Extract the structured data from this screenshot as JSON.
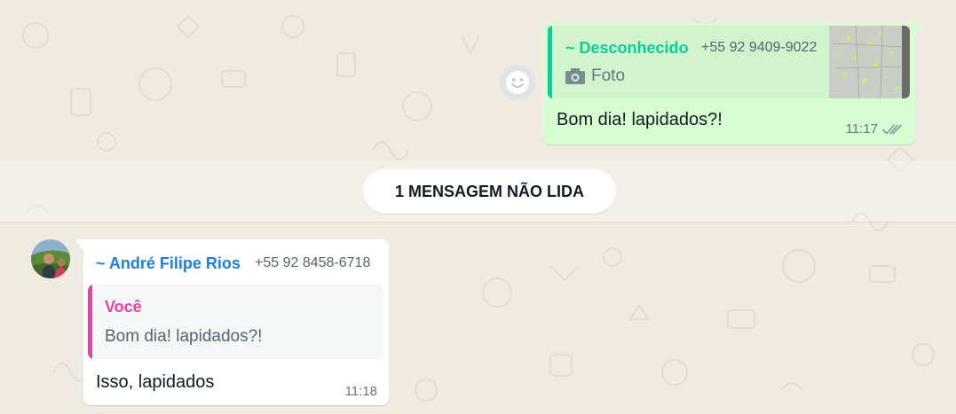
{
  "outgoing": {
    "quote": {
      "author": "~ Desconhecido",
      "phone": "+55 92 9409-9022",
      "media_icon": "camera-icon",
      "media_label": "Foto"
    },
    "text": "Bom dia! lapidados?!",
    "time": "11:17",
    "status_icon": "double-check-icon"
  },
  "divider": {
    "label": "1 MENSAGEM NÃO LIDA"
  },
  "incoming": {
    "sender_name": "~ André Filipe Rios",
    "sender_phone": "+55 92 8458-6718",
    "quote": {
      "author": "Você",
      "text": "Bom dia! lapidados?!"
    },
    "text": "Isso, lapidados",
    "time": "11:18"
  },
  "colors": {
    "chat_background": "#efeae2",
    "outgoing_bubble": "#d9fdd3",
    "incoming_bubble": "#ffffff",
    "outgoing_quote_accent": "#06cf9c",
    "incoming_quote_accent": "#e542a3",
    "sender_name": "#1b7fe0"
  }
}
